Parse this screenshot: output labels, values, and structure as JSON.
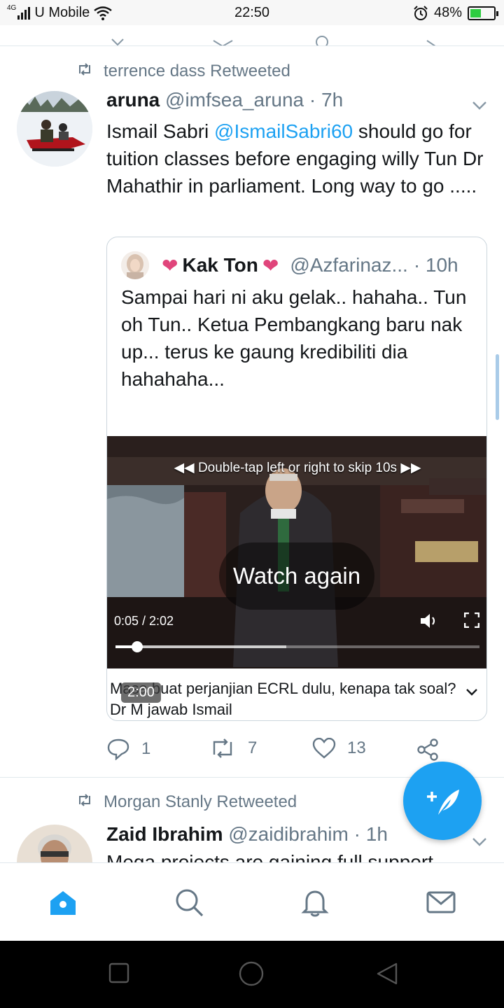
{
  "status_bar": {
    "network": "4G",
    "carrier": "U Mobile",
    "time": "22:50",
    "battery": "48%",
    "battery_level": 0.48
  },
  "tweets": [
    {
      "retweeted_by": "terrence dass Retweeted",
      "name": "aruna",
      "handle": "@imfsea_aruna",
      "age": "· 7h",
      "text_before": "Ismail Sabri ",
      "mention": "@IsmailSabri60",
      "text_after": " should go for tuition classes before engaging willy Tun Dr Mahathir in parliament. Long way to go .....",
      "quote": {
        "heart_left": "❤",
        "name": "Kak Ton",
        "heart_right": "❤",
        "handle": "@Azfarinaz...",
        "age": "· 10h",
        "text": "Sampai hari ni aku gelak.. hahaha.. Tun oh Tun.. Ketua Pembangkang baru nak up... terus ke gaung kredibiliti dia hahahaha...",
        "ellipsis": "...",
        "video": {
          "skip_hint": "Double-tap left or right to skip 10s",
          "watch_again": "Watch again",
          "time": "0:05 / 2:02",
          "played_fraction": 0.06,
          "loaded_fraction": 0.47,
          "duration_badge": "2:00",
          "caption": "Masa buat perjanjian ECRL dulu, kenapa tak soal? Dr M jawab Ismail"
        }
      },
      "actions": {
        "replies": "1",
        "retweets": "7",
        "likes": "13"
      }
    },
    {
      "retweeted_by": "Morgan Stanly Retweeted",
      "name": "Zaid Ibrahim",
      "handle": "@zaidibrahim",
      "age": "· 1h",
      "text": "Mega projects are gaining full support"
    }
  ],
  "colors": {
    "accent": "#1da1f2",
    "secondary_text": "#657786",
    "heart": "#e0457b"
  },
  "icons": {
    "nav": [
      "home-icon",
      "search-icon",
      "notifications-icon",
      "messages-icon"
    ],
    "fab": "compose-tweet-icon"
  }
}
